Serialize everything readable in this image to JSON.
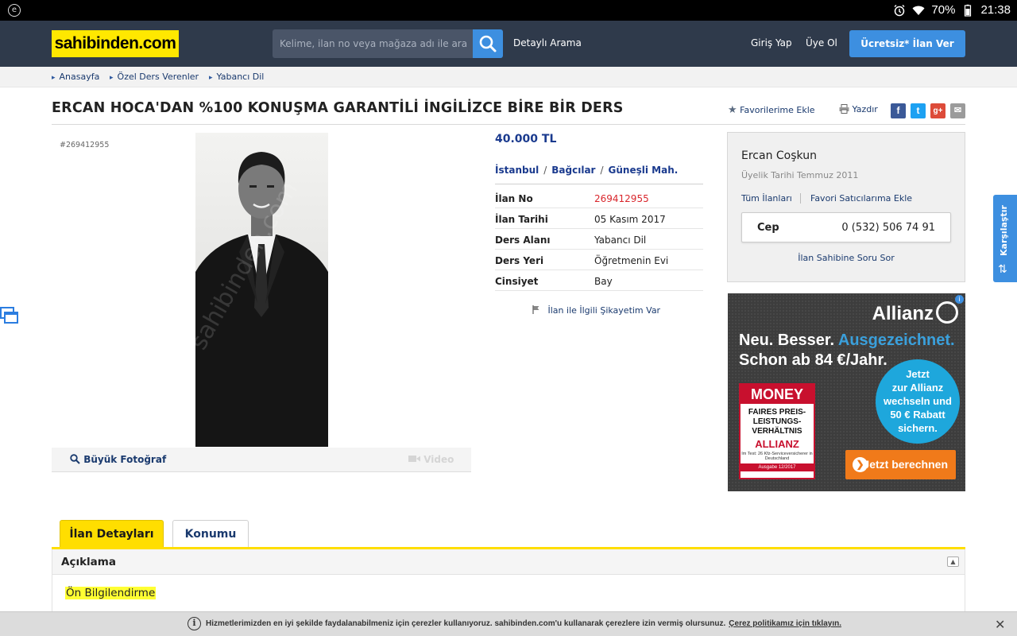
{
  "statusbar": {
    "battery": "70%",
    "time": "21:38",
    "app_icon": "e"
  },
  "header": {
    "logo": "sahibinden.com",
    "search_placeholder": "Kelime, ilan no veya mağaza adı ile ara",
    "detailed_search": "Detaylı Arama",
    "login": "Giriş Yap",
    "register": "Üye Ol",
    "post_ad": "Ücretsiz* İlan Ver"
  },
  "breadcrumb": [
    "Anasayfa",
    "Özel Ders Verenler",
    "Yabancı Dil"
  ],
  "listing": {
    "title": "ERCAN HOCA'DAN %100 KONUŞMA GARANTİLİ İNGİLİZCE BİRE BİR DERS",
    "add_favorites": "Favorilerime Ekle",
    "print": "Yazdır",
    "share": [
      "f",
      "t",
      "g+",
      "✉"
    ],
    "id_label": "#269412955",
    "big_photo": "Büyük Fotoğraf",
    "video": "Video",
    "watermark": "sahibinden.com",
    "price": "40.000 TL",
    "location": [
      "İstanbul",
      "Bağcılar",
      "Güneşli Mah."
    ],
    "location_sep": "/",
    "details": [
      {
        "key": "İlan No",
        "value": "269412955",
        "highlight": true
      },
      {
        "key": "İlan Tarihi",
        "value": "05 Kasım 2017"
      },
      {
        "key": "Ders Alanı",
        "value": "Yabancı Dil"
      },
      {
        "key": "Ders Yeri",
        "value": "Öğretmenin Evi"
      },
      {
        "key": "Cinsiyet",
        "value": "Bay"
      }
    ],
    "complaint": "İlan ile İlgili Şikayetim Var"
  },
  "seller": {
    "name": "Ercan Coşkun",
    "member_since": "Üyelik Tarihi  Temmuz 2011",
    "all_ads": "Tüm İlanları",
    "fav_seller": "Favori Satıcılarıma Ekle",
    "phone_label": "Cep",
    "phone": "0 (532) 506 74 91",
    "ask": "İlan Sahibine Soru Sor"
  },
  "ad": {
    "brand": "Allianz",
    "line1a": "Neu. Besser. ",
    "line1b": "Ausgezeichnet.",
    "line2": "Schon ab 84 €/Jahr.",
    "circle": [
      "Jetzt",
      "zur Allianz",
      "wechseln und",
      "50 € Rabatt",
      "sichern."
    ],
    "badge_top": "MONEY",
    "badge_l1": "FAIRES PREIS-LEISTUNGS-VERHÄLTNIS",
    "badge_l2": "ALLIANZ",
    "badge_l3": "Im Test: 26 Kfz-Serviceversicherer in Deutschland",
    "badge_l4": "Ausgabe 12/2017",
    "cta": "Jetzt berechnen",
    "choice": "i"
  },
  "compare_tab": "Karşılaştır",
  "tabs": {
    "details": "İlan Detayları",
    "location": "Konumu"
  },
  "description": {
    "title": "Açıklama",
    "first_line": "Ön Bilgilendirme"
  },
  "cookie": {
    "message": "Hizmetlerimizden en iyi şekilde faydalanabilmeniz için çerezler kullanıyoruz. sahibinden.com'u kullanarak çerezlere izin vermiş olursunuz.",
    "policy": "Çerez politikamız için tıklayın.",
    "close": "✕"
  },
  "colors": {
    "header": "#2f3a4b",
    "logo_yellow": "#ffe800",
    "accent_blue": "#3d8fe0",
    "tab_yellow": "#ffde00",
    "link": "#1a3a6e",
    "red": "#d9262c"
  }
}
